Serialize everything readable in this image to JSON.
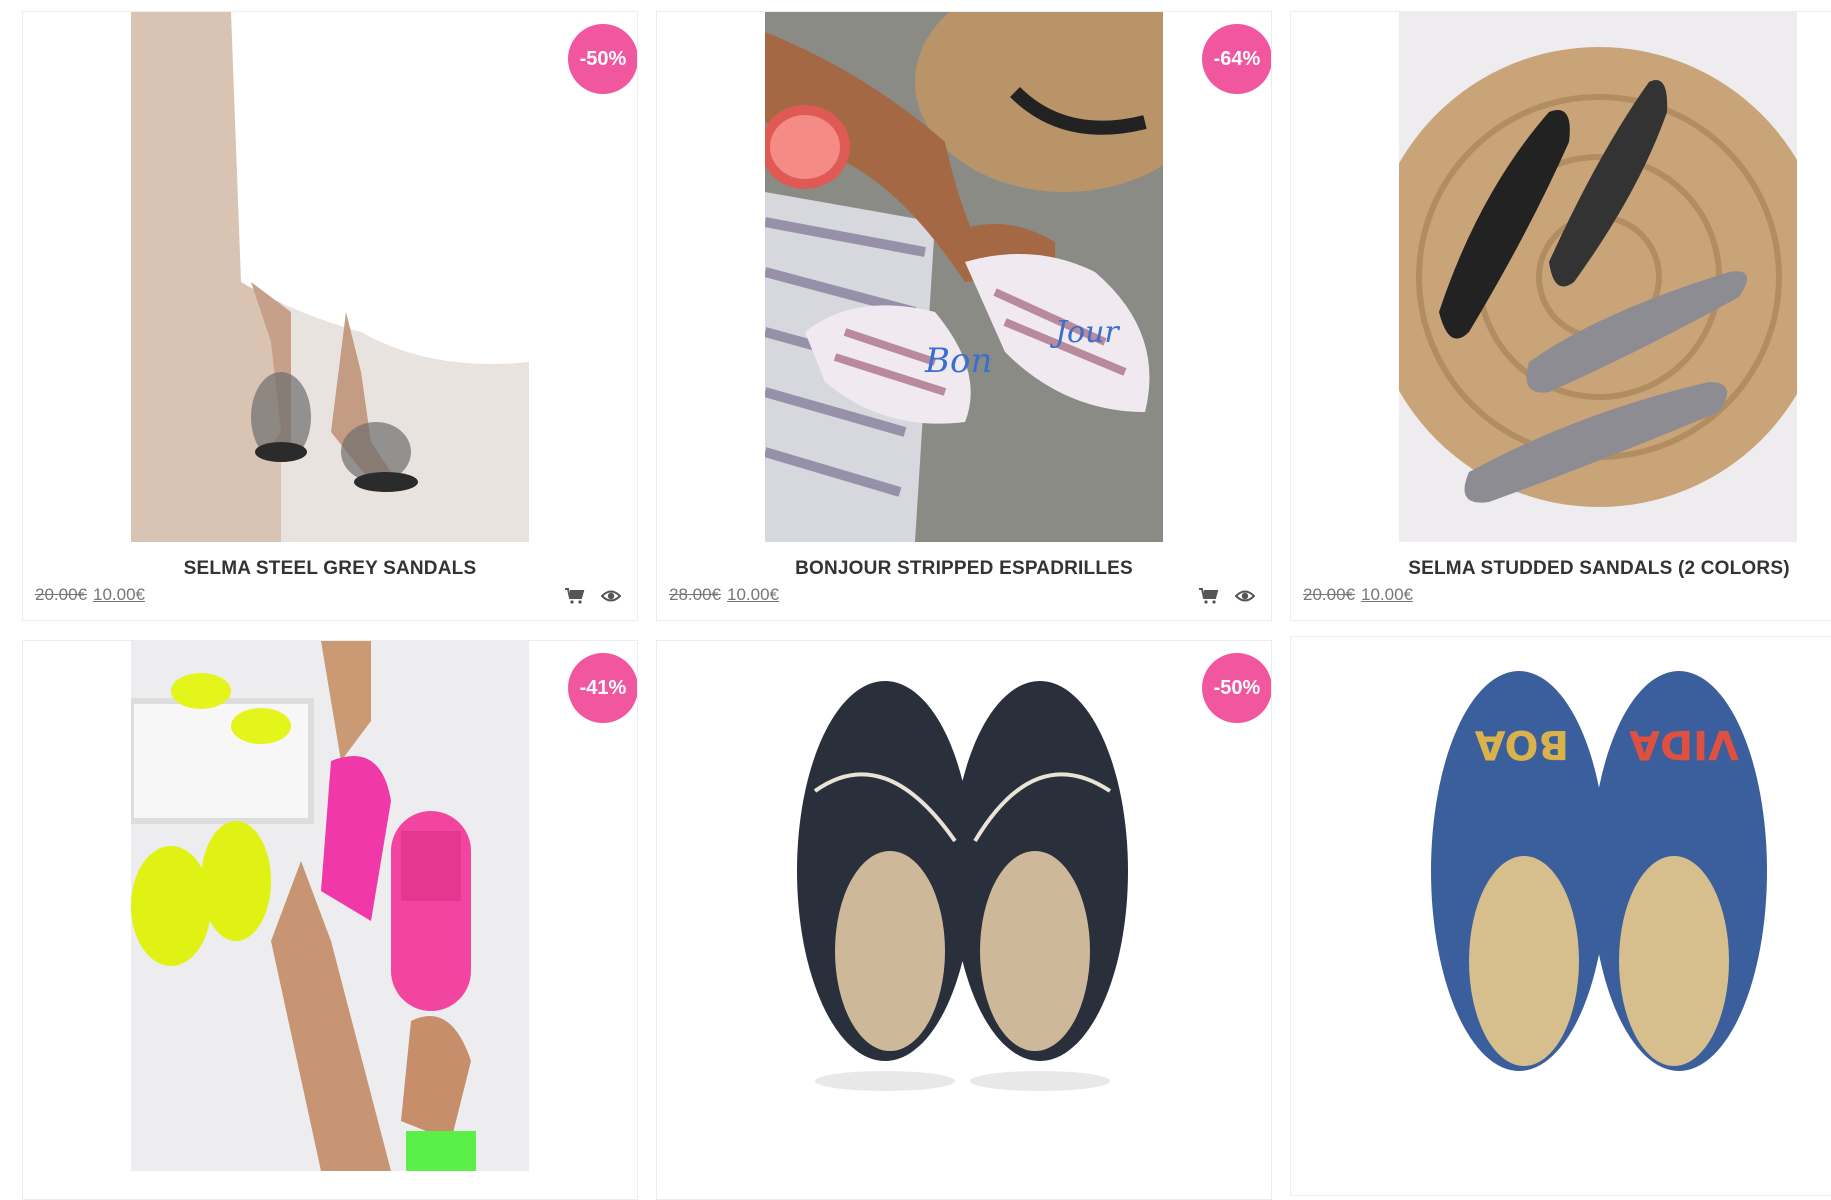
{
  "products": [
    {
      "name": "SELMA STEEL GREY SANDALS",
      "old_price": "20.00€",
      "new_price": "10.00€",
      "badge": "-50%"
    },
    {
      "name": "BONJOUR STRIPPED ESPADRILLES",
      "old_price": "28.00€",
      "new_price": "10.00€",
      "badge": "-64%"
    },
    {
      "name": "SELMA STUDDED SANDALS (2 COLORS)",
      "old_price": "20.00€",
      "new_price": "10.00€",
      "badge": ""
    },
    {
      "name": "",
      "old_price": "",
      "new_price": "",
      "badge": "-41%"
    },
    {
      "name": "",
      "old_price": "",
      "new_price": "",
      "badge": "-50%"
    },
    {
      "name": "",
      "old_price": "",
      "new_price": "",
      "badge": ""
    }
  ],
  "icons": {
    "cart": "cart-icon",
    "quick_view": "eye-icon"
  },
  "colors": {
    "badge": "#f0579f",
    "title": "#333333",
    "price": "#777777",
    "border": "#ececec"
  }
}
